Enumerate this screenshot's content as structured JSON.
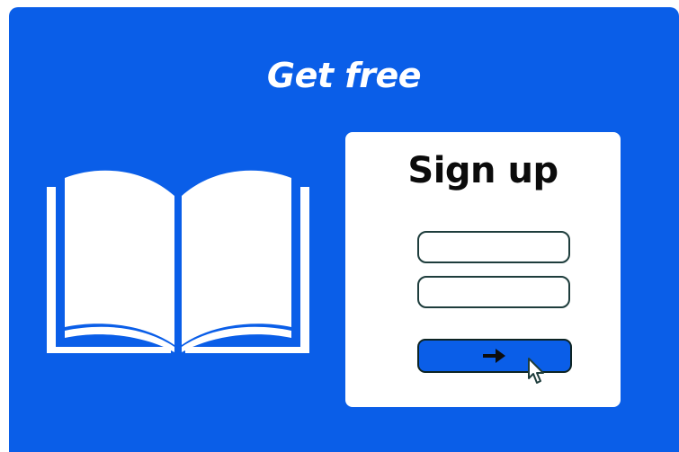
{
  "banner": {
    "headline": "Get free",
    "background_color": "#0a5ee8"
  },
  "illustration": {
    "icon": "open-book-icon"
  },
  "signup_card": {
    "title": "Sign up",
    "field_1": {
      "value": "",
      "placeholder": ""
    },
    "field_2": {
      "value": "",
      "placeholder": ""
    },
    "submit_button": {
      "icon": "arrow-right-icon"
    },
    "cursor": {
      "icon": "pointer-hand-icon"
    }
  }
}
